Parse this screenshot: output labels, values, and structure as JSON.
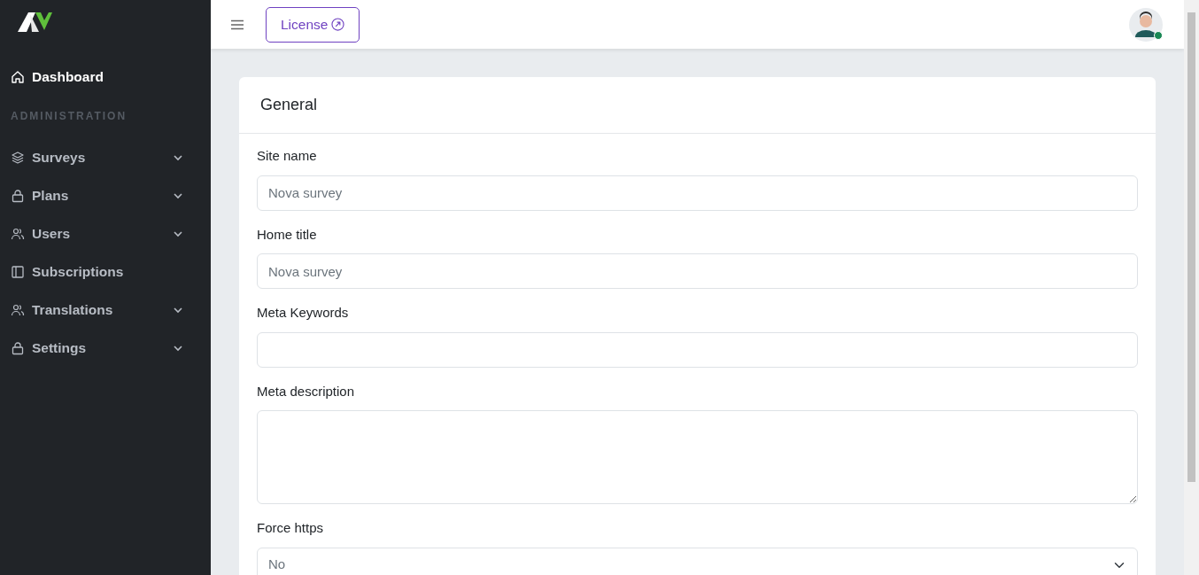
{
  "sidebar": {
    "items": [
      {
        "kind": "link",
        "label": "Dashboard",
        "selected": true,
        "expandable": false
      },
      {
        "kind": "heading",
        "label": "ADMINISTRATION"
      },
      {
        "kind": "link",
        "label": "Surveys",
        "selected": false,
        "expandable": true
      },
      {
        "kind": "link",
        "label": "Plans",
        "selected": false,
        "expandable": true
      },
      {
        "kind": "link",
        "label": "Users",
        "selected": false,
        "expandable": true
      },
      {
        "kind": "link",
        "label": "Subscriptions",
        "selected": false,
        "expandable": false
      },
      {
        "kind": "link",
        "label": "Translations",
        "selected": false,
        "expandable": true
      },
      {
        "kind": "link",
        "label": "Settings",
        "selected": false,
        "expandable": true
      }
    ]
  },
  "header": {
    "license_button": "License",
    "user": {
      "online": true
    }
  },
  "card": {
    "title": "General",
    "fields": [
      {
        "kind": "input",
        "label": "Site name",
        "placeholder": "Nova survey"
      },
      {
        "kind": "input",
        "label": "Home title",
        "placeholder": "Nova survey"
      },
      {
        "kind": "input",
        "label": "Meta Keywords"
      },
      {
        "kind": "textarea",
        "label": "Meta description"
      },
      {
        "kind": "select",
        "label": "Force https",
        "value": "No"
      }
    ]
  }
}
